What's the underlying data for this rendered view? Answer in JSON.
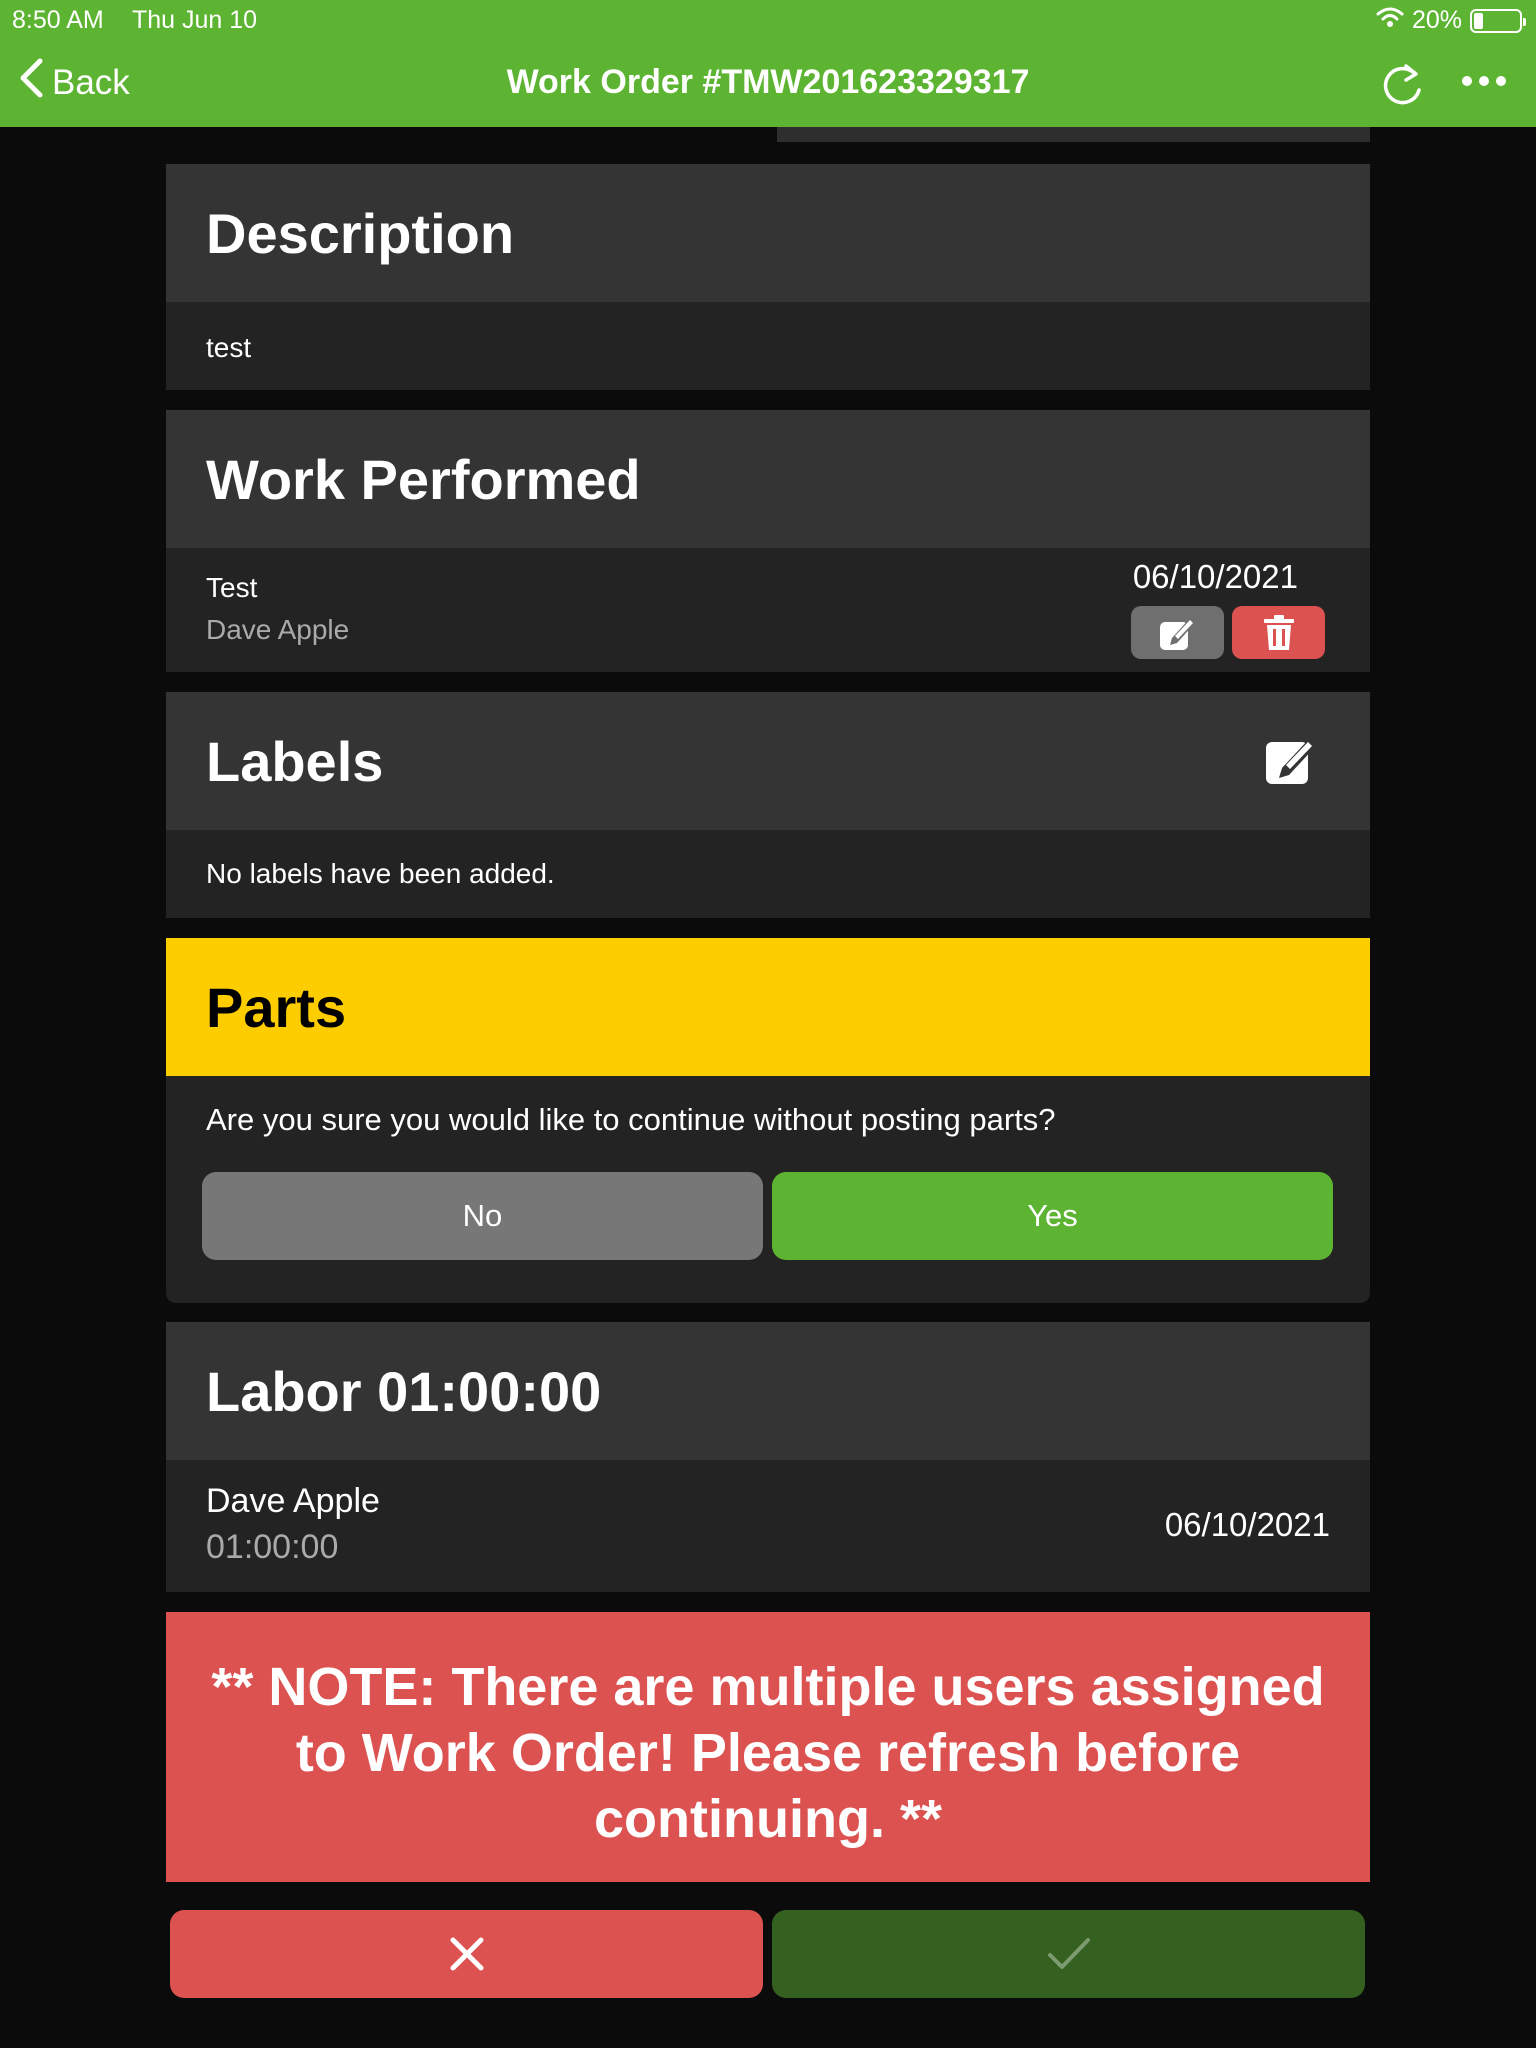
{
  "status_bar": {
    "time": "8:50 AM",
    "date": "Thu Jun 10",
    "battery": "20%"
  },
  "nav": {
    "back_label": "Back",
    "title": "Work Order #TMW201623329317"
  },
  "description": {
    "heading": "Description",
    "text": "test"
  },
  "work_performed": {
    "heading": "Work Performed",
    "entry": {
      "title": "Test",
      "author": "Dave Apple",
      "date": "06/10/2021"
    }
  },
  "labels": {
    "heading": "Labels",
    "empty_text": "No labels have been added."
  },
  "parts": {
    "heading": "Parts",
    "prompt": "Are you sure you would like to continue without posting parts?",
    "no_label": "No",
    "yes_label": "Yes"
  },
  "labor": {
    "heading": "Labor 01:00:00",
    "entry": {
      "name": "Dave Apple",
      "duration": "01:00:00",
      "date": "06/10/2021"
    }
  },
  "note": {
    "text": "** NOTE: There are multiple users assigned to Work Order! Please refresh before continuing. **"
  },
  "colors": {
    "nav_green": "#5db432",
    "parts_yellow": "#fecd00",
    "danger_red": "#dc5250",
    "confirm_dark_green": "#346020",
    "neutral_gray": "#777777"
  }
}
